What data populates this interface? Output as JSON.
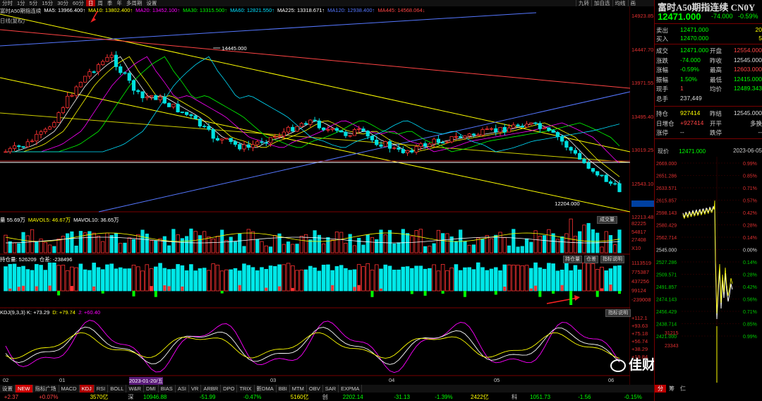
{
  "toolbar": {
    "tabs": [
      "分时",
      "1分",
      "5分",
      "15分",
      "30分",
      "60分",
      "日",
      "周",
      "季",
      "年",
      "多周期",
      "设置"
    ],
    "active_tab": "日",
    "right_tabs": [
      "九转",
      "加自选",
      "均线",
      "画"
    ]
  },
  "ma_legend": [
    {
      "label": "富时A50期指连续",
      "color": "#dddddd"
    },
    {
      "label": "MA5: 13966.400↑",
      "color": "#ffffff"
    },
    {
      "label": "MA10: 13802.400↑",
      "color": "#ffff00"
    },
    {
      "label": "MA20: 13452.100↑",
      "color": "#ff00ff"
    },
    {
      "label": "MA30: 13315.500↑",
      "color": "#00ff00"
    },
    {
      "label": "MA60: 12821.550↑",
      "color": "#00e0ff"
    },
    {
      "label": "MA225: 13318.671↑",
      "color": "#ffffff"
    },
    {
      "label": "MA120: 12938.400↑",
      "color": "#5577ff"
    },
    {
      "label": "MA445: 14568.064↓",
      "color": "#ff4444"
    }
  ],
  "chart_labels": {
    "dayline": "日线(复权)",
    "high_label": "14445.000",
    "low_label": "12204.000"
  },
  "price_axis": [
    "14923.85",
    "14447.70",
    "13971.55",
    "13495.40",
    "13019.25",
    "12543.10",
    "12213.48"
  ],
  "vol_legend": [
    {
      "label": "量 55.69万",
      "color": "#ffffff"
    },
    {
      "label": "MAVOL5: 46.67万",
      "color": "#ffff00"
    },
    {
      "label": "MAVOL10: 36.65万",
      "color": "#ffffff"
    }
  ],
  "vol_axis": [
    "82225",
    "54817",
    "27408",
    "X10"
  ],
  "vol_button": "成交量",
  "oi_legend": [
    {
      "label": "持仓量: 526209",
      "color": "#ffffff"
    },
    {
      "label": "仓差: -238496",
      "color": "#ffffff"
    }
  ],
  "oi_axis": [
    "1113519",
    "775387",
    "437256",
    "99124",
    "-239008"
  ],
  "oi_buttons": [
    "持仓量",
    "仓差",
    "指标说明"
  ],
  "kdj_legend": [
    {
      "label": "KDJ(9,3,3) K: +73.29",
      "color": "#ffffff"
    },
    {
      "label": "D: +79.74",
      "color": "#ffff00"
    },
    {
      "label": "J: +60.40",
      "color": "#ff00ff"
    }
  ],
  "kdj_axis": [
    "+112.1",
    "+93.63",
    "+75.18",
    "+56.74",
    "+38.29",
    "+19.84"
  ],
  "kdj_button": "指标说明",
  "x_dates": [
    {
      "label": "02",
      "x": 4
    },
    {
      "label": "01",
      "x": 84
    },
    {
      "label": "2023-01-20/五",
      "x": 183,
      "highlight": true
    },
    {
      "label": "03",
      "x": 383
    },
    {
      "label": "04",
      "x": 551
    },
    {
      "label": "05",
      "x": 700
    },
    {
      "label": "06",
      "x": 862
    }
  ],
  "bottom_tabs": [
    "设置",
    "NEW",
    "指标广场",
    "MACD",
    "KDJ",
    "RSI",
    "BOLL",
    "W&R",
    "DMI",
    "BIAS",
    "ASI",
    "VR",
    "ARBR",
    "DPO",
    "TRIX",
    "新DMA",
    "BBI",
    "MTM",
    "OBV",
    "SAR",
    "EXPMA"
  ],
  "bottom_active": "KDJ",
  "status_bar": [
    {
      "text": "+2.37",
      "color": "#ff4444"
    },
    {
      "text": "+0.07%",
      "color": "#ff4444"
    },
    {
      "text": "3570亿",
      "color": "#ffff00"
    },
    {
      "text": "深",
      "color": "#ccc"
    },
    {
      "text": "10946.88",
      "color": "#00ff00"
    },
    {
      "text": "-51.99",
      "color": "#00ff00"
    },
    {
      "text": "-0.47%",
      "color": "#00ff00"
    },
    {
      "text": "5160亿",
      "color": "#ffff00"
    },
    {
      "text": "创",
      "color": "#ccc"
    },
    {
      "text": "2202.14",
      "color": "#00ff00"
    },
    {
      "text": "-31.13",
      "color": "#00ff00"
    },
    {
      "text": "-1.39%",
      "color": "#00ff00"
    },
    {
      "text": "2422亿",
      "color": "#ffff00"
    },
    {
      "text": "科",
      "color": "#ccc"
    },
    {
      "text": "1051.73",
      "color": "#00ff00"
    },
    {
      "text": "-1.56",
      "color": "#00ff00"
    },
    {
      "text": "-0.15%",
      "color": "#00ff00"
    },
    {
      "text": "730亿",
      "color": "#ffff00"
    }
  ],
  "side": {
    "title": "富时A50期指连续 CN0Y",
    "price": "12471.000",
    "change": "-74.000",
    "pct": "-0.59%",
    "quotes": [
      {
        "label": "卖出",
        "value": "12471.000",
        "right": "20"
      },
      {
        "label": "买入",
        "value": "12470.000",
        "right": "5"
      }
    ],
    "stats": [
      {
        "l": "成交",
        "v": "12471.000",
        "l2": "开盘",
        "v2": "12554.000",
        "vc": "#00ff00",
        "v2c": "#ff4444"
      },
      {
        "l": "涨跌",
        "v": "-74.000",
        "l2": "昨收",
        "v2": "12545.000",
        "vc": "#00ff00",
        "v2c": "#dddddd"
      },
      {
        "l": "涨幅",
        "v": "-0.59%",
        "l2": "最高",
        "v2": "12603.000",
        "vc": "#00ff00",
        "v2c": "#ff4444"
      },
      {
        "l": "振幅",
        "v": "1.50%",
        "l2": "最低",
        "v2": "12415.000",
        "vc": "#00ff00",
        "v2c": "#00ff00"
      },
      {
        "l": "现手",
        "v": "1",
        "l2": "均价",
        "v2": "12489.343",
        "vc": "#ff4444",
        "v2c": "#00ff00"
      },
      {
        "l": "总手",
        "v": "237,449",
        "l2": "",
        "v2": "",
        "vc": "#dddddd",
        "v2c": "#dddddd"
      }
    ],
    "oi": [
      {
        "l": "持仓",
        "v": "927414",
        "l2": "昨结",
        "v2": "12545.000",
        "vc": "#ffff00",
        "v2c": "#dddddd"
      },
      {
        "l": "日增仓",
        "v": "+927414",
        "l2": "开平",
        "v2": "多换",
        "vc": "#ff4444",
        "v2c": "#dddddd"
      },
      {
        "l": "涨停",
        "v": "--",
        "l2": "跌停",
        "v2": "--",
        "vc": "#dddddd",
        "v2c": "#dddddd"
      }
    ],
    "mini_header": {
      "label": "现价",
      "price": "12471.000",
      "date": "2023-06-05"
    },
    "mini_left": [
      "2669.000",
      "2651.286",
      "2633.571",
      "2615.857",
      "2598.143",
      "2580.429",
      "2562.714",
      "2545.000",
      "2527.286",
      "2509.571",
      "2491.857",
      "2474.143",
      "2456.429",
      "2438.714",
      "2421.000"
    ],
    "mini_right": [
      "0.99%",
      "0.85%",
      "0.71%",
      "0.57%",
      "0.42%",
      "0.28%",
      "0.14%",
      "0.00%",
      "0.14%",
      "0.28%",
      "0.42%",
      "0.56%",
      "0.71%",
      "0.85%",
      "0.99%"
    ],
    "mini_vol": [
      "31215",
      "23343"
    ],
    "mini_tabs": [
      "分",
      "筹",
      "仁"
    ]
  },
  "watermark": "佳财一分钟",
  "series": {
    "candle_seed": 7,
    "colors": {
      "up": "#ff3333",
      "down": "#00e0e0"
    }
  }
}
